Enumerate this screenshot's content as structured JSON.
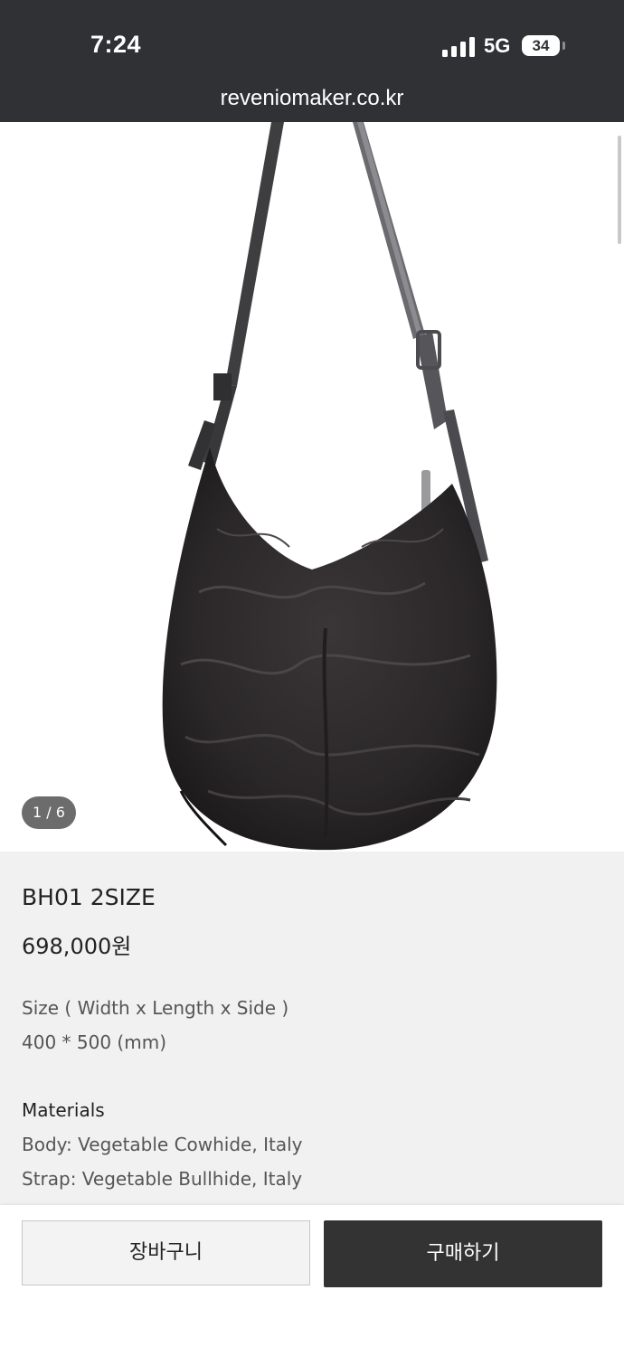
{
  "status_bar": {
    "time": "7:24",
    "network": "5G",
    "battery": "34",
    "icons": [
      "signal-icon",
      "battery-icon"
    ]
  },
  "browser": {
    "url": "reveniomaker.co.kr"
  },
  "gallery": {
    "counter": "1 / 6",
    "current": 1,
    "total": 6
  },
  "product": {
    "title": "BH01 2SIZE",
    "price": "698,000원",
    "size_label": "Size ( Width x  Length  x Side )",
    "size_value": "400 * 500 (mm)",
    "materials_heading": "Materials",
    "material_body": "Body: Vegetable Cowhide, Italy",
    "material_strap": "Strap: Vegetable Bullhide, Italy"
  },
  "actions": {
    "cart_label": "장바구니",
    "buy_label": "구매하기"
  },
  "colors": {
    "topbar": "#2f3135",
    "info_background": "#f1f1f1",
    "buy_button": "#333333"
  }
}
